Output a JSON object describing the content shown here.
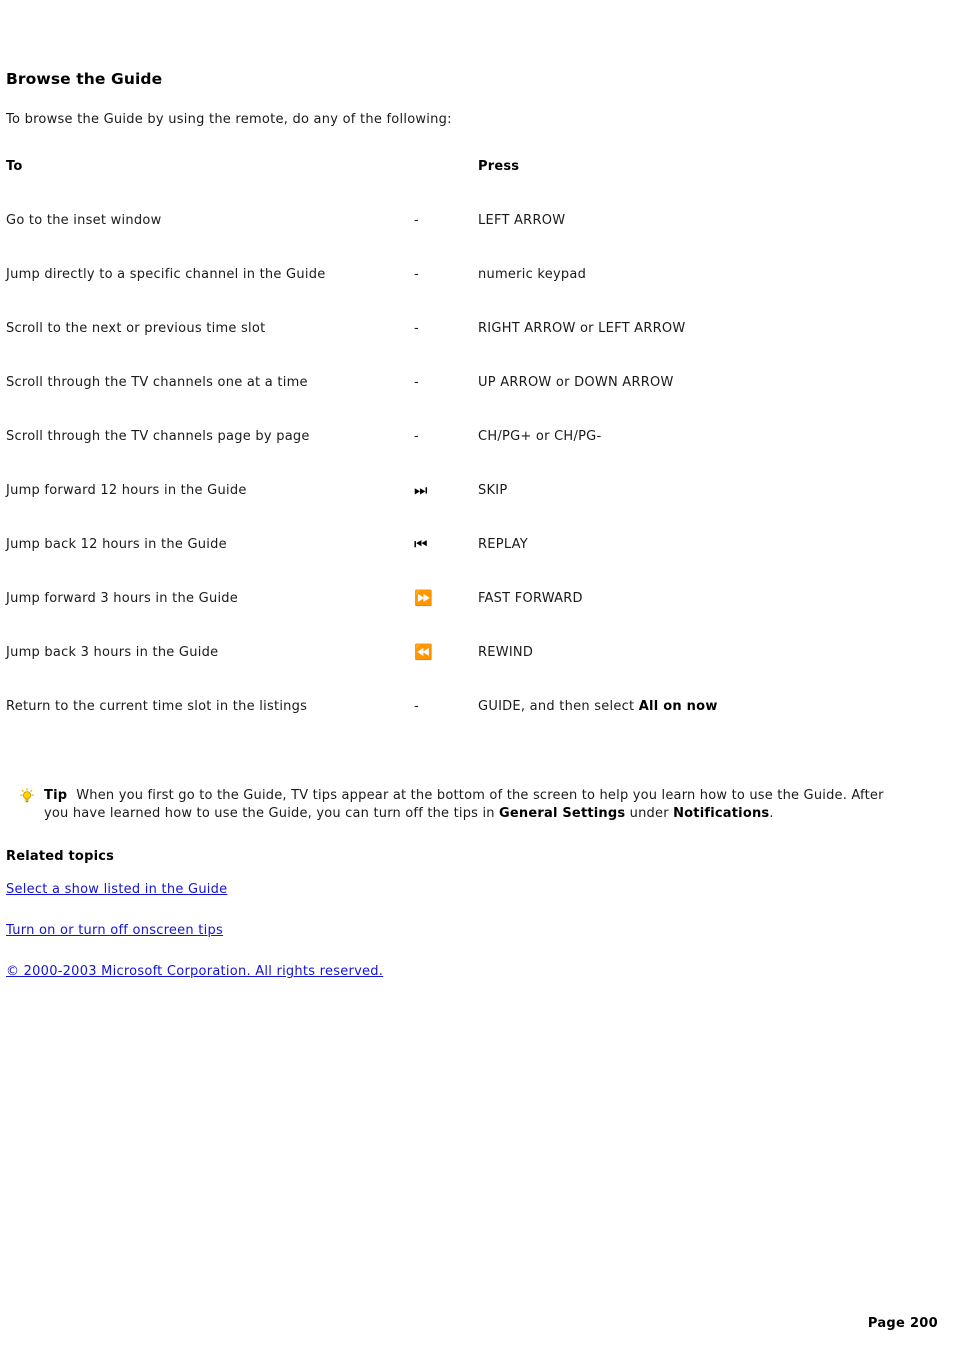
{
  "page": {
    "title": "Browse the Guide",
    "intro": "To browse the Guide by using the remote, do any of the following:",
    "footer": "Page 200"
  },
  "table": {
    "headers": {
      "action": "To",
      "press": "Press"
    },
    "rows": [
      {
        "action": "Go to the inset window",
        "glyph": "-",
        "glyph_name": "dash",
        "press": "LEFT ARROW"
      },
      {
        "action": "Jump directly to a specific channel in the Guide",
        "glyph": "-",
        "glyph_name": "dash",
        "press": "numeric keypad"
      },
      {
        "action": "Scroll to the next or previous time slot",
        "glyph": "-",
        "glyph_name": "dash",
        "press": "RIGHT ARROW or LEFT ARROW"
      },
      {
        "action": "Scroll through the TV channels one at a time",
        "glyph": "-",
        "glyph_name": "dash",
        "press": "UP ARROW or DOWN ARROW"
      },
      {
        "action": "Scroll through the TV channels page by page",
        "glyph": "-",
        "glyph_name": "dash",
        "press": "CH/PG+ or CH/PG-"
      },
      {
        "action": "Jump forward 12 hours in the Guide",
        "glyph": "⏭",
        "glyph_name": "skip-forward-icon",
        "press": "SKIP"
      },
      {
        "action": "Jump back 12 hours in the Guide",
        "glyph": "⏮",
        "glyph_name": "skip-back-icon",
        "press": "REPLAY"
      },
      {
        "action": "Jump forward 3 hours in the Guide",
        "glyph": "⏩",
        "glyph_name": "fast-forward-icon",
        "press": "FAST FORWARD"
      },
      {
        "action": "Jump back 3 hours in the Guide",
        "glyph": "⏪",
        "glyph_name": "rewind-icon",
        "press": "REWIND"
      },
      {
        "action": "Return to the current time slot in the listings",
        "glyph": "-",
        "glyph_name": "dash",
        "press_prefix": "GUIDE, and then select ",
        "press_bold": "All on now"
      }
    ]
  },
  "tip": {
    "icon_name": "lightbulb-icon",
    "label": "Tip",
    "text_1": "When you first go to the Guide, TV tips appear at the bottom of the screen to help you learn how to use the Guide. After you have learned how to use the Guide, you can turn off the tips in ",
    "bold_1": "General Settings",
    "text_2": " under ",
    "bold_2": "Notifications",
    "text_3": "."
  },
  "related": {
    "heading": "Related topics",
    "links": [
      "Select a show listed in the Guide",
      "Turn on or turn off onscreen tips",
      "© 2000-2003 Microsoft Corporation. All rights reserved."
    ]
  },
  "colors": {
    "link": "#1414d2",
    "text": "#1a1a1a",
    "bulb": "#ffd400"
  }
}
